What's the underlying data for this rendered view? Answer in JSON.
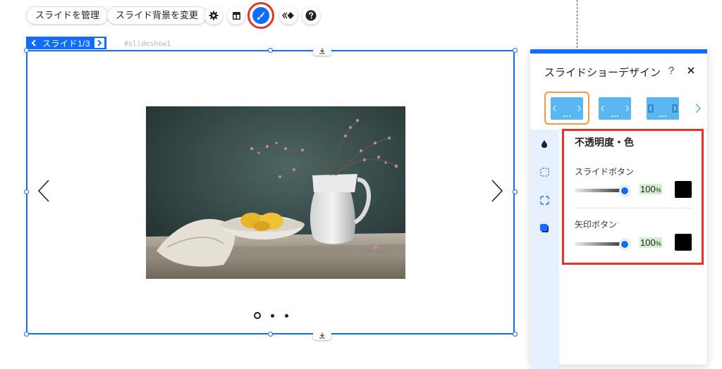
{
  "toolbar": {
    "manage_slides_label": "スライドを管理",
    "change_background_label": "スライド背景を変更",
    "icons": [
      "gear-icon",
      "layout-icon",
      "paint-brush-icon",
      "animation-icon",
      "help-icon"
    ]
  },
  "slide_nav": {
    "label": "スライド1/3",
    "anchor": "#slideshow1"
  },
  "slideshow": {
    "current_slide": 1,
    "total_slides": 3,
    "accent_color": "#116dff"
  },
  "design_panel": {
    "title": "スライドショーデザイン",
    "help": "?",
    "section_title": "不透明度・色",
    "slide_button": {
      "label": "スライドボタン",
      "opacity": "100",
      "unit": "%",
      "opacity_fraction": 1.0,
      "color": "#000000"
    },
    "arrow_button": {
      "label": "矢印ボタン",
      "opacity": "100",
      "unit": "%",
      "opacity_fraction": 1.0,
      "color": "#000000"
    },
    "rail_icons": [
      "drop-icon",
      "dashed-square-icon",
      "corners-icon",
      "shadow-square-icon"
    ],
    "highlight_color": "#e5322d"
  }
}
